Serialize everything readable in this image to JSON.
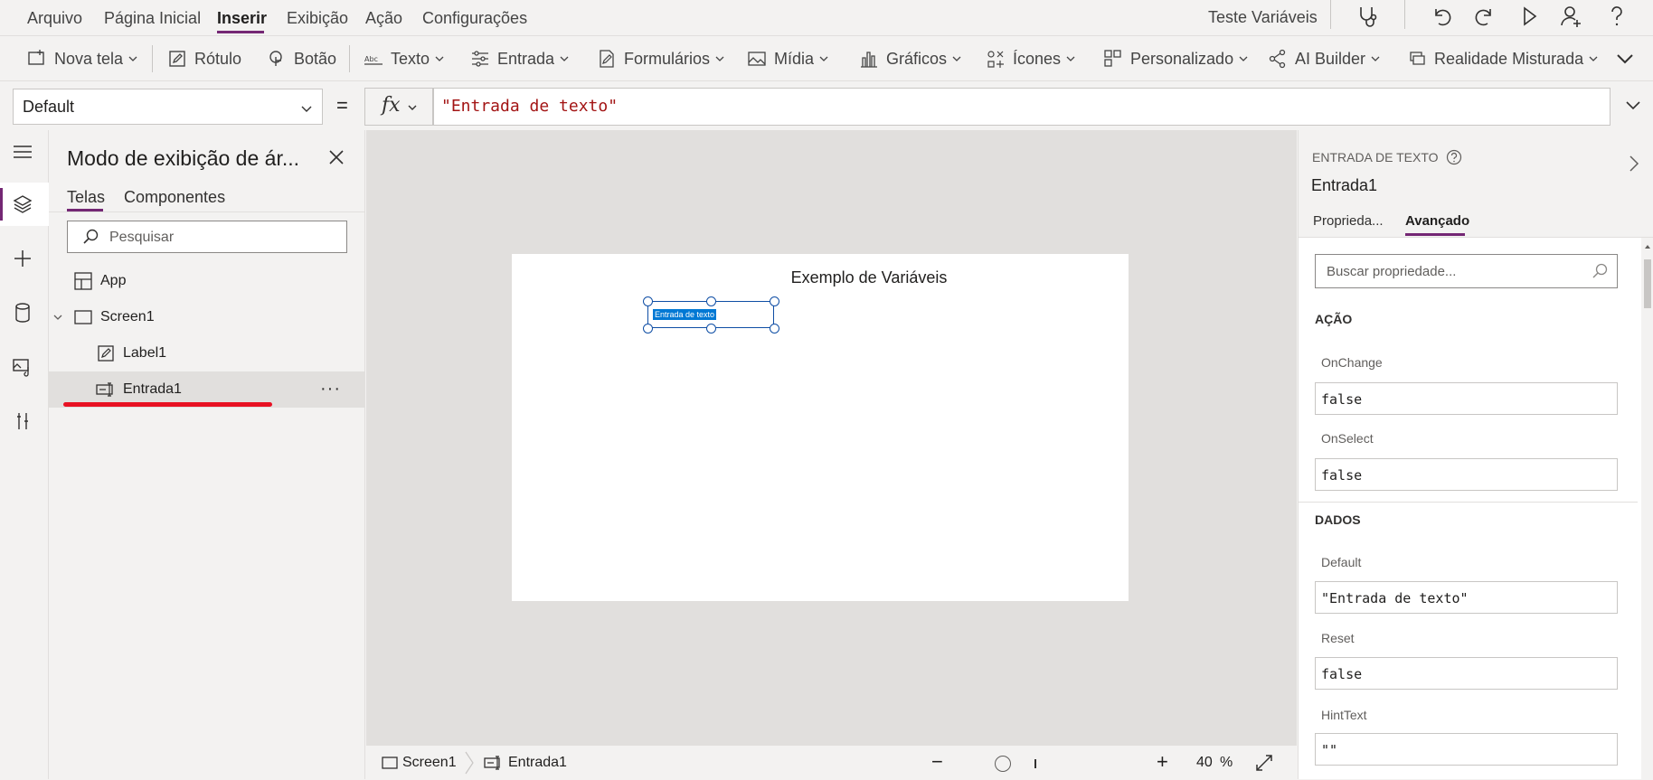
{
  "menu": {
    "items": [
      "Arquivo",
      "Página Inicial",
      "Inserir",
      "Exibição",
      "Ação",
      "Configurações"
    ],
    "active": "Inserir",
    "app_name": "Teste Variáveis"
  },
  "ribbon": {
    "nova_tela": "Nova tela",
    "rotulo": "Rótulo",
    "botao": "Botão",
    "texto": "Texto",
    "entrada": "Entrada",
    "formularios": "Formulários",
    "midia": "Mídia",
    "graficos": "Gráficos",
    "icones": "Ícones",
    "personalizado": "Personalizado",
    "ai_builder": "AI Builder",
    "realidade": "Realidade Misturada"
  },
  "formula_bar": {
    "property": "Default",
    "equals": "=",
    "fx": "fx",
    "formula": "\"Entrada de texto\""
  },
  "tree": {
    "title": "Modo de exibição de ár...",
    "tabs": [
      "Telas",
      "Componentes"
    ],
    "search_placeholder": "Pesquisar",
    "nodes": {
      "app": "App",
      "screen1": "Screen1",
      "label1": "Label1",
      "entrada1": "Entrada1"
    },
    "more": "···"
  },
  "canvas": {
    "screen_title": "Exemplo de Variáveis",
    "input_text": "Entrada de texto"
  },
  "statusbar": {
    "screen": "Screen1",
    "control": "Entrada1",
    "zoom_minus": "−",
    "zoom_plus": "+",
    "zoom_value": "40",
    "zoom_unit": "%"
  },
  "right_panel": {
    "control_type": "ENTRADA DE TEXTO",
    "control_name": "Entrada1",
    "tabs": [
      "Proprieda...",
      "Avançado"
    ],
    "search_placeholder": "Buscar propriedade...",
    "sections": {
      "acao": "AÇÃO",
      "dados": "DADOS"
    },
    "props": {
      "onchange_label": "OnChange",
      "onchange_value": "false",
      "onselect_label": "OnSelect",
      "onselect_value": "false",
      "default_label": "Default",
      "default_value": "\"Entrada de texto\"",
      "reset_label": "Reset",
      "reset_value": "false",
      "hinttext_label": "HintText",
      "hinttext_value": "\"\""
    }
  },
  "colors": {
    "accent": "#742774",
    "selection": "#0078d4",
    "red_underline": "#e81123",
    "formula_text": "#a31515"
  }
}
